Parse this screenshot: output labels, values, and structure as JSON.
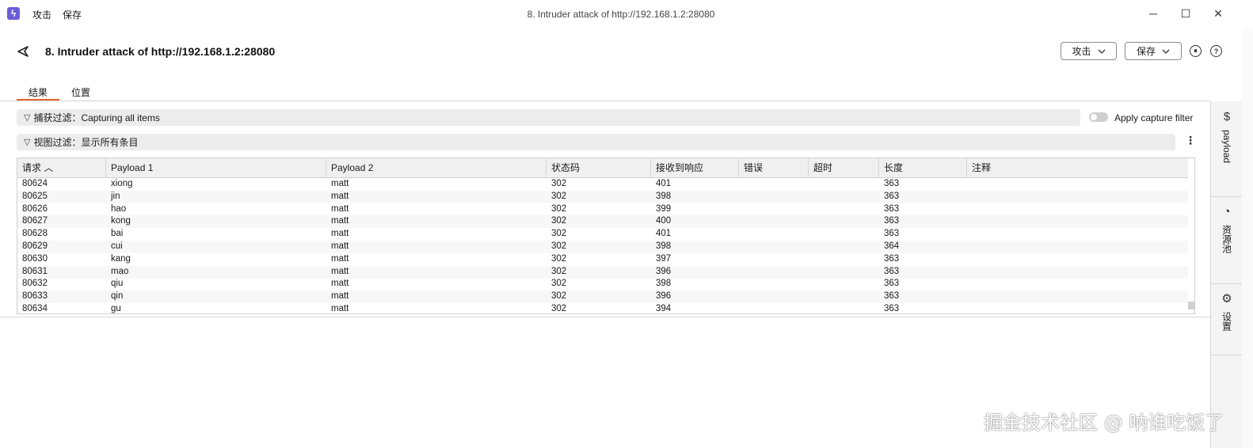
{
  "titlebar": {
    "app_icon": "lightning-icon",
    "menu": [
      "攻击",
      "保存"
    ],
    "title": "8. Intruder attack of http://192.168.1.2:28080",
    "minimize": "─",
    "maximize": "☐",
    "close": "✕"
  },
  "header": {
    "title": "8. Intruder attack of http://192.168.1.2:28080",
    "attack_btn": "攻击",
    "save_btn": "保存",
    "pause_icon": "⏸",
    "help_icon": "?"
  },
  "tabs": [
    {
      "label": "结果",
      "active": true
    },
    {
      "label": "位置",
      "active": false
    }
  ],
  "filters": {
    "capture": "捕获过滤：Capturing all items",
    "view": "视图过滤：显示所有条目",
    "apply_capture_label": "Apply capture filter"
  },
  "side_panel": {
    "items": [
      {
        "label": "payload",
        "icon": "$"
      },
      {
        "label": "资源池",
        "icon": "◔"
      },
      {
        "label": "设置",
        "icon": "⚙"
      }
    ]
  },
  "table": {
    "columns": [
      "请求 ︿",
      "Payload 1",
      "Payload 2",
      "状态码",
      "接收到响应",
      "错误",
      "超时",
      "长度",
      "注释"
    ],
    "rows": [
      [
        "80624",
        "xiong",
        "matt",
        "302",
        "401",
        "",
        "",
        "363",
        ""
      ],
      [
        "80625",
        "jin",
        "matt",
        "302",
        "398",
        "",
        "",
        "363",
        ""
      ],
      [
        "80626",
        "hao",
        "matt",
        "302",
        "399",
        "",
        "",
        "363",
        ""
      ],
      [
        "80627",
        "kong",
        "matt",
        "302",
        "400",
        "",
        "",
        "363",
        ""
      ],
      [
        "80628",
        "bai",
        "matt",
        "302",
        "401",
        "",
        "",
        "363",
        ""
      ],
      [
        "80629",
        "cui",
        "matt",
        "302",
        "398",
        "",
        "",
        "364",
        ""
      ],
      [
        "80630",
        "kang",
        "matt",
        "302",
        "397",
        "",
        "",
        "363",
        ""
      ],
      [
        "80631",
        "mao",
        "matt",
        "302",
        "396",
        "",
        "",
        "363",
        ""
      ],
      [
        "80632",
        "qiu",
        "matt",
        "302",
        "398",
        "",
        "",
        "363",
        ""
      ],
      [
        "80633",
        "qin",
        "matt",
        "302",
        "396",
        "",
        "",
        "363",
        ""
      ],
      [
        "80634",
        "gu",
        "matt",
        "302",
        "394",
        "",
        "",
        "363",
        ""
      ]
    ]
  },
  "watermark": "掘金技术社区 @ 呐谁吃饭了",
  "colors": {
    "accent": "#e8622c",
    "app_icon": "#6b5cd6"
  }
}
